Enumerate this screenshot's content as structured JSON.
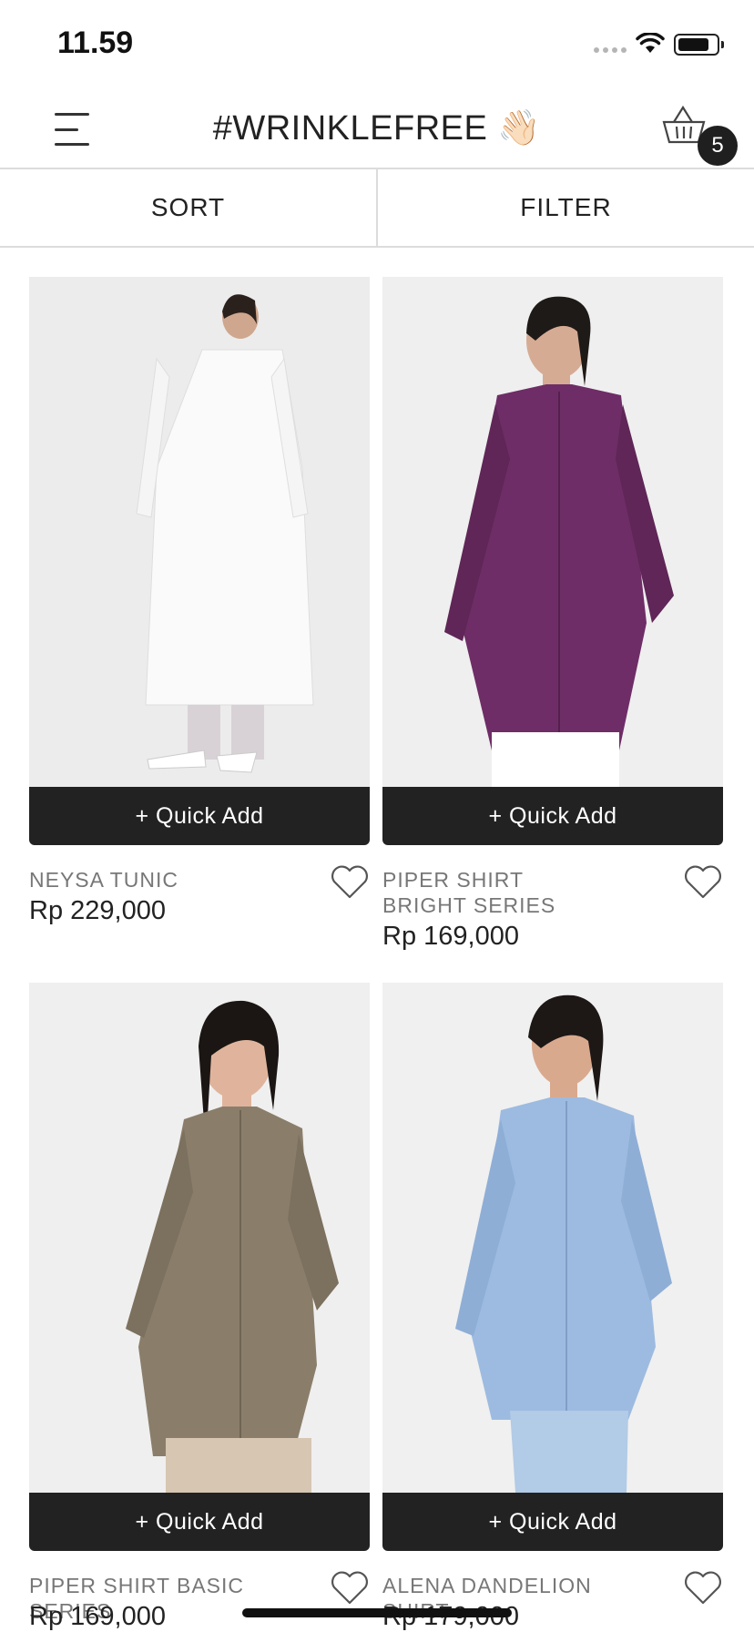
{
  "status_bar": {
    "time": "11.59"
  },
  "header": {
    "title": "#WRINKLEFREE",
    "title_emoji": "👋🏻",
    "cart_count": "5"
  },
  "toolbar": {
    "sort_label": "SORT",
    "filter_label": "FILTER"
  },
  "products": [
    {
      "name": "NEYSA TUNIC",
      "price": "Rp 229,000",
      "quick_add": "+ Quick Add",
      "color": "#f4f4f2"
    },
    {
      "name": "PIPER SHIRT\nBRIGHT SERIES",
      "price": "Rp 169,000",
      "quick_add": "+ Quick Add",
      "color": "#6e2d66"
    },
    {
      "name": "PIPER SHIRT BASIC SERIES",
      "price": "Rp 169,000",
      "quick_add": "+ Quick Add",
      "color": "#8a7e6b"
    },
    {
      "name": "ALENA DANDELION SHIRT",
      "price": "Rp 179,000",
      "quick_add": "+ Quick Add",
      "color": "#9dbbe0"
    }
  ]
}
